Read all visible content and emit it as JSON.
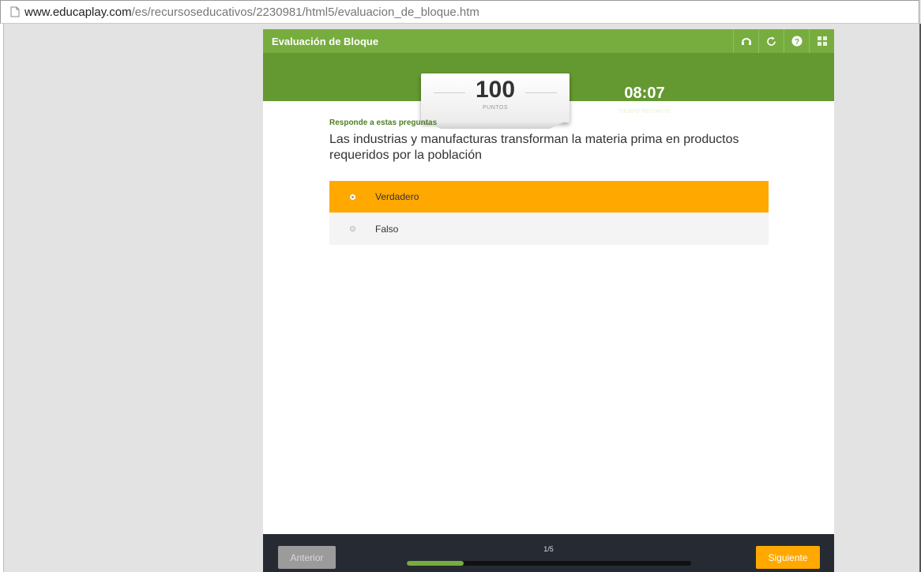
{
  "browser": {
    "url_host": "www.educaplay.com",
    "url_path": "/es/recursoseducativos/2230981/html5/evaluacion_de_bloque.htm"
  },
  "app": {
    "title": "Evaluación de Bloque",
    "toolbar_icons": [
      "headset-icon",
      "restart-icon",
      "help-icon",
      "grid-icon"
    ],
    "accent_color": "#77ad3f",
    "header_dark": "#649830",
    "selected_color": "#ffa800"
  },
  "score": {
    "value": "100",
    "label": "PUNTOS"
  },
  "timer": {
    "value": "08:07",
    "label": "TIEMPO RESTANTE"
  },
  "question": {
    "prompt": "Responde a estas preguntas",
    "text": "Las industrias y manufacturas transforman la materia prima en productos requeridos por la población",
    "options": [
      {
        "label": "Verdadero",
        "selected": true
      },
      {
        "label": "Falso",
        "selected": false
      }
    ]
  },
  "brand": {
    "prefix": "educa",
    "suffix": "play"
  },
  "footer": {
    "prev_label": "Anterior",
    "next_label": "Siguiente",
    "progress_text": "1/5",
    "progress_fraction": 0.2
  }
}
